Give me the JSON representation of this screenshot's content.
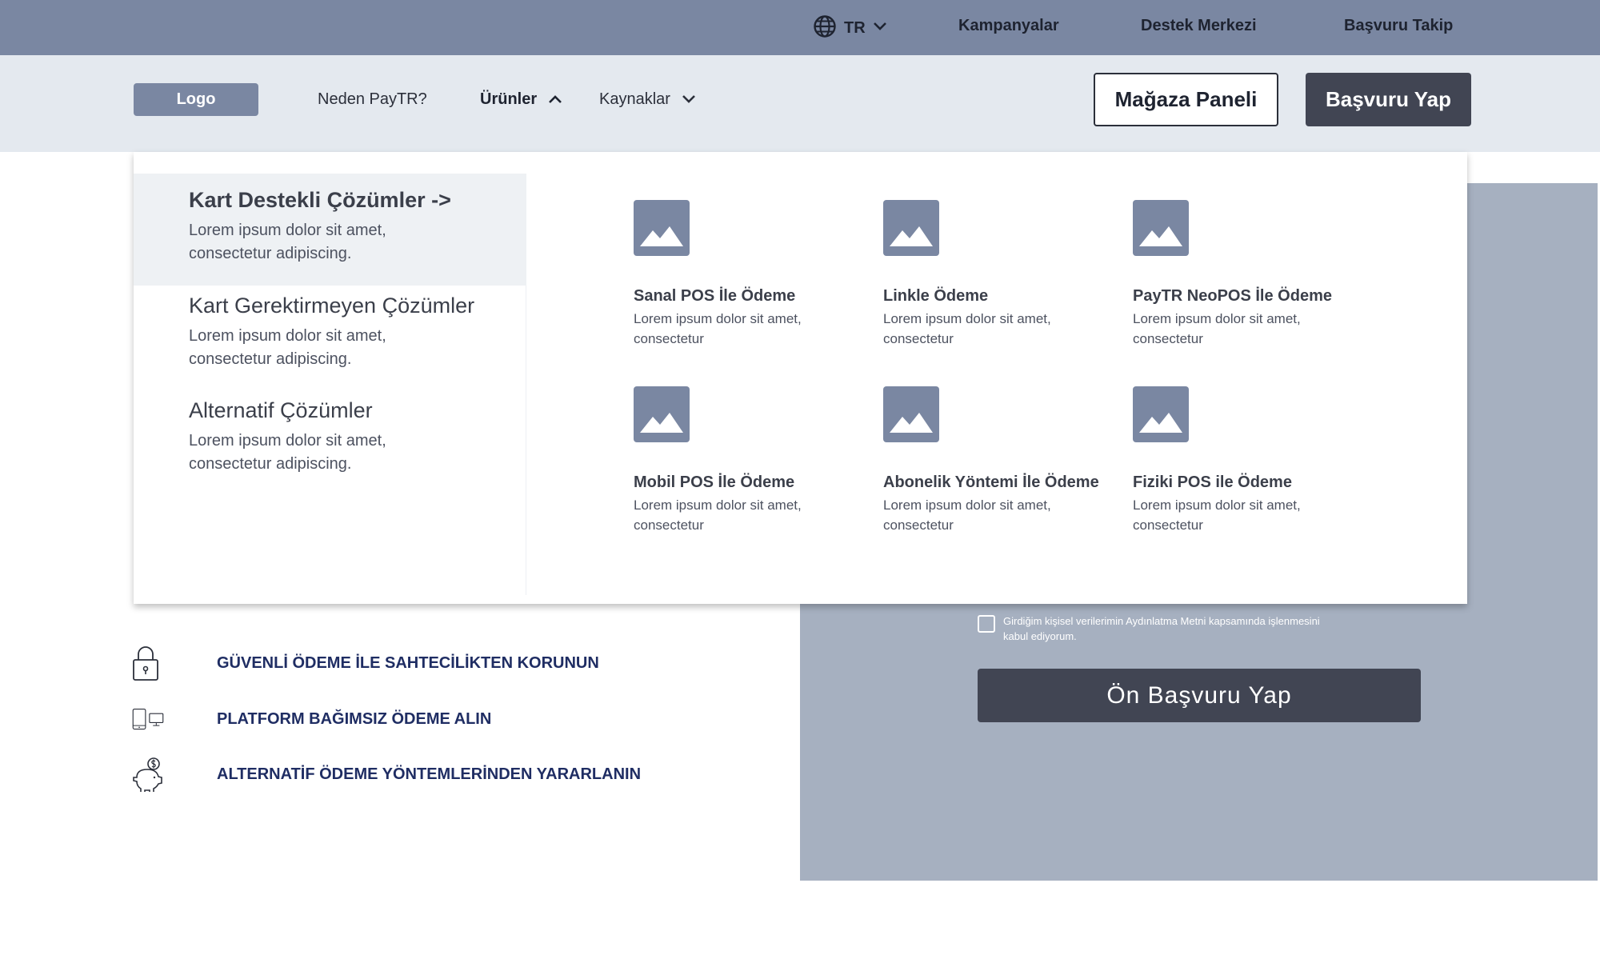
{
  "topbar": {
    "language": "TR",
    "links": [
      "Kampanyalar",
      "Destek Merkezi",
      "Başvuru Takip"
    ]
  },
  "nav": {
    "logo": "Logo",
    "items": [
      {
        "label": "Neden PayTR?"
      },
      {
        "label": "Ürünler"
      },
      {
        "label": "Kaynaklar"
      }
    ],
    "store_panel": "Mağaza Paneli",
    "apply": "Başvuru Yap"
  },
  "menu": {
    "categories": [
      {
        "title": "Kart Destekli Çözümler ->",
        "desc1": "Lorem ipsum dolor sit amet,",
        "desc2": "consectetur adipiscing."
      },
      {
        "title": "Kart Gerektirmeyen Çözümler",
        "desc1": "Lorem ipsum dolor sit amet,",
        "desc2": "consectetur adipiscing."
      },
      {
        "title": "Alternatif Çözümler",
        "desc1": "Lorem ipsum dolor sit amet,",
        "desc2": "consectetur adipiscing."
      }
    ],
    "products": [
      {
        "title": "Sanal POS İle Ödeme",
        "desc1": "Lorem ipsum dolor sit amet,",
        "desc2": "consectetur"
      },
      {
        "title": "Linkle Ödeme",
        "desc1": "Lorem ipsum dolor sit amet,",
        "desc2": "consectetur"
      },
      {
        "title": "PayTR NeoPOS İle Ödeme",
        "desc1": "Lorem ipsum dolor sit amet,",
        "desc2": "consectetur"
      },
      {
        "title": "Mobil POS İle Ödeme",
        "desc1": "Lorem ipsum dolor sit amet,",
        "desc2": "consectetur"
      },
      {
        "title": "Abonelik Yöntemi İle Ödeme",
        "desc1": "Lorem ipsum dolor sit amet,",
        "desc2": "consectetur"
      },
      {
        "title": "Fiziki POS ile Ödeme",
        "desc1": "Lorem ipsum dolor sit amet,",
        "desc2": "consectetur"
      }
    ]
  },
  "features": [
    {
      "icon": "lock-icon",
      "text": "GÜVENLİ ÖDEME İLE SAHTECİLİKTEN KORUNUN"
    },
    {
      "icon": "devices-icon",
      "text": "PLATFORM BAĞIMSIZ ÖDEME ALIN"
    },
    {
      "icon": "piggy-bank-icon",
      "text": "ALTERNATİF ÖDEME YÖNTEMLERİNDEN YARARLANIN"
    }
  ],
  "form": {
    "consent": "Girdiğim kişisel verilerimin Aydınlatma Metni kapsamında işlenmesini kabul ediyorum.",
    "submit": "Ön Başvuru Yap"
  },
  "colors": {
    "topbar": "#7a87a2",
    "navbar": "#e4e9ef",
    "form_panel": "#a6b0c0",
    "dark_button": "#414553",
    "feature_text": "#1f2d63"
  }
}
